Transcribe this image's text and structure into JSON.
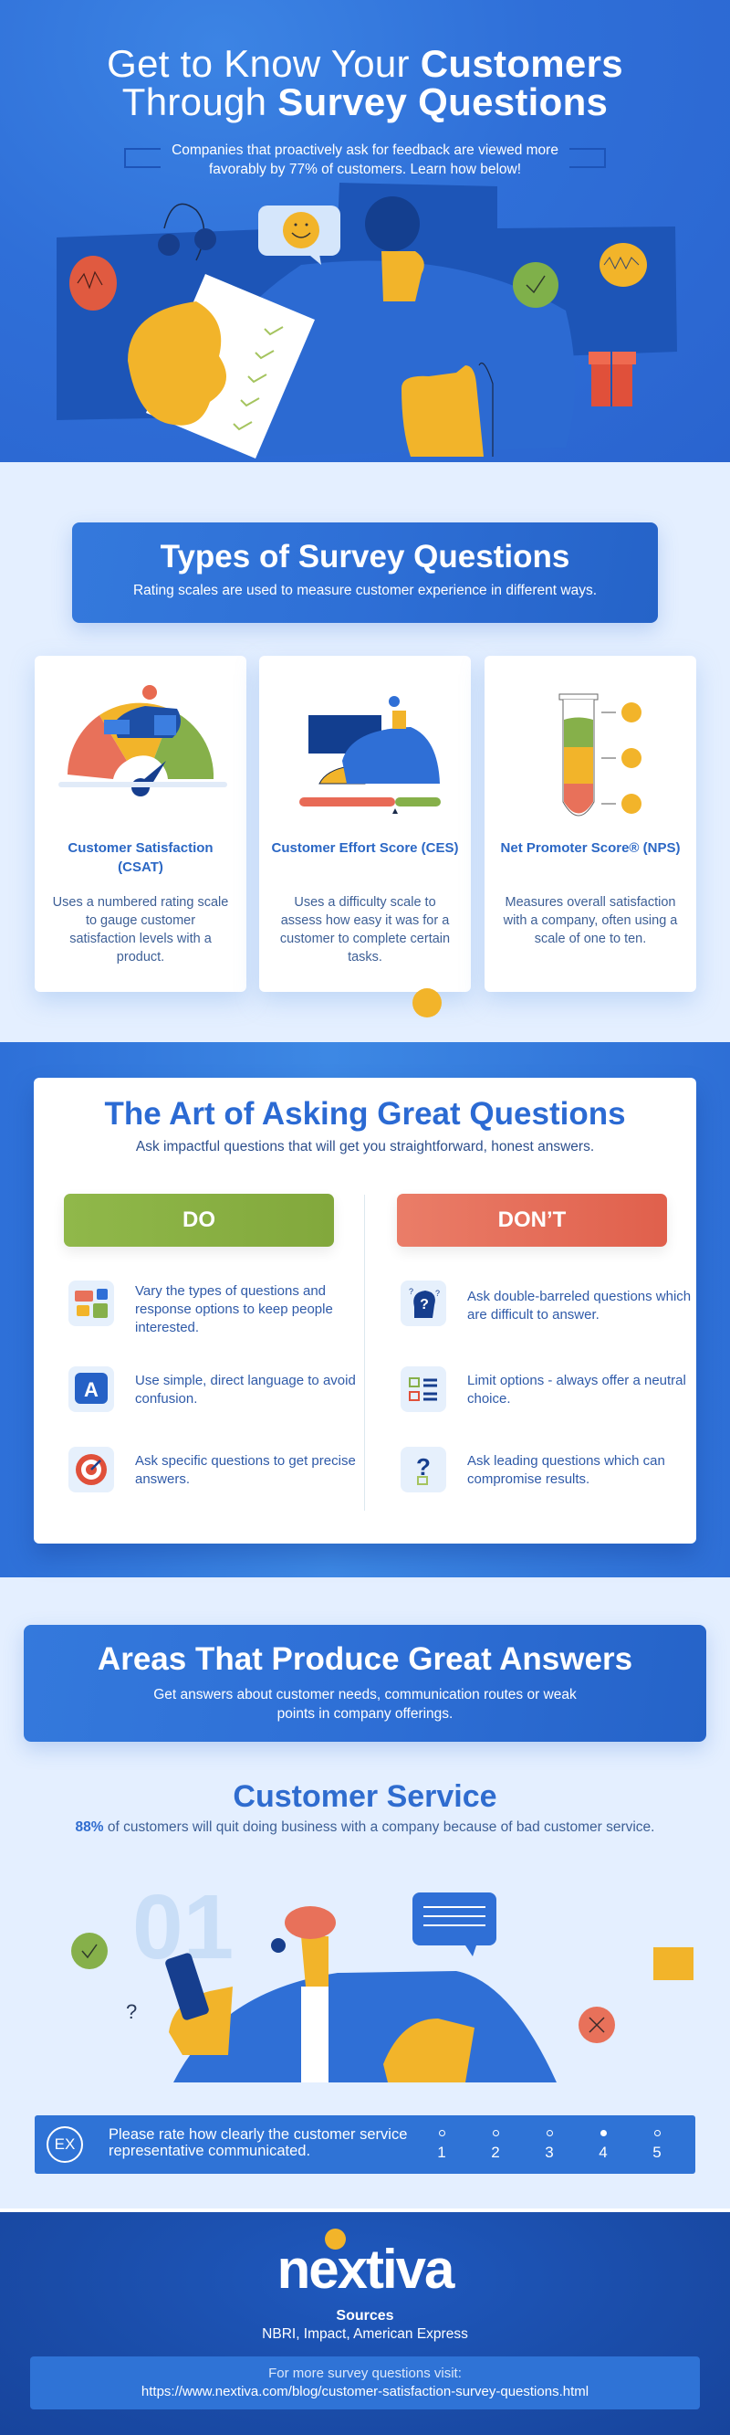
{
  "hero": {
    "title_line1_light": "Get to Know Your",
    "title_line1_bold": "Customers",
    "title_line2_light": "Through",
    "title_line2_bold": "Survey Questions",
    "subtitle": "Companies that proactively ask for feedback are viewed more favorably by 77% of customers. Learn how below!"
  },
  "types_section": {
    "title": "Types of Survey Questions",
    "subtitle": "Rating scales are used to measure customer experience in different ways.",
    "cards": [
      {
        "icon": "satisfaction-gauge",
        "title": "Customer Satisfaction (CSAT)",
        "description": "Uses a numbered rating scale to gauge customer satisfaction levels with a product."
      },
      {
        "icon": "effort-slider",
        "title": "Customer Effort Score (CES)",
        "description": "Uses a difficulty scale to assess how easy it was for a customer to complete certain tasks."
      },
      {
        "icon": "test-tube",
        "title": "Net Promoter Score® (NPS)",
        "description": "Measures overall satisfaction with a company, often using a scale of one to ten."
      }
    ]
  },
  "art_section": {
    "title": "The Art of Asking Great Questions",
    "subtitle": "Ask impactful questions that will get you straightforward, honest answers.",
    "do_label": "DO",
    "dont_label": "DON’T",
    "do_items": [
      {
        "icon": "speech-bubbles",
        "text": "Vary the types of questions and response options to keep people interested."
      },
      {
        "icon": "letter-a-bubble",
        "text": "Use simple, direct language to avoid confusion."
      },
      {
        "icon": "target",
        "text": "Ask specific questions to get precise answers."
      }
    ],
    "dont_items": [
      {
        "icon": "confused-head",
        "text": "Ask double-barreled questions which are difficult to answer."
      },
      {
        "icon": "checklist",
        "text": "Limit options - always offer a neutral choice."
      },
      {
        "icon": "question-mark",
        "text": "Ask leading questions which can compromise results."
      }
    ]
  },
  "areas_section": {
    "title": "Areas That Produce Great Answers",
    "subtitle": "Get answers about customer needs, communication routes or weak points in company offerings.",
    "area": {
      "number": "01",
      "title": "Customer Service",
      "stat": "88%",
      "stat_text": "of customers will quit doing business with a company because of bad customer service."
    },
    "example": {
      "badge": "EX",
      "question": "Please rate how clearly the customer service representative communicated.",
      "options": [
        "1",
        "2",
        "3",
        "4",
        "5"
      ],
      "selected": "4"
    }
  },
  "footer": {
    "logo": "nextiva",
    "sources_title": "Sources",
    "sources": "NBRI, Impact, American Express",
    "more_label": "For more survey questions visit:",
    "more_url": "https://www.nextiva.com/blog/customer-satisfaction-survey-questions.html"
  },
  "colors": {
    "brand_blue": "#2f6fd6",
    "dark_blue": "#1a4ca8",
    "do_green": "#86ad40",
    "dont_red": "#e4674f",
    "accent_yellow": "#f2b42a"
  }
}
